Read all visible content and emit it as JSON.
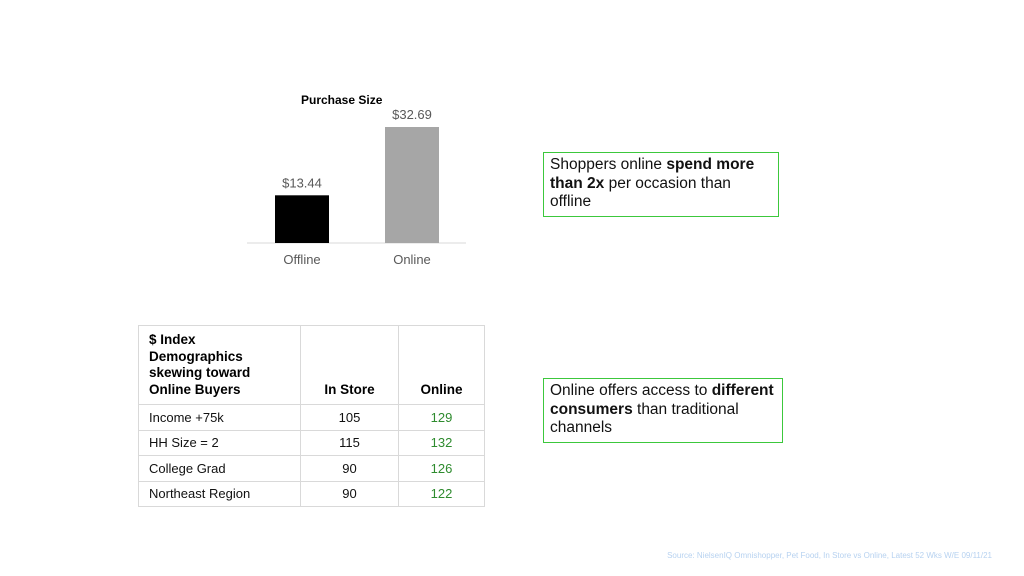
{
  "chart_data": {
    "type": "bar",
    "title": "Purchase Size",
    "categories": [
      "Offline",
      "Online"
    ],
    "values": [
      13.44,
      32.69
    ],
    "data_labels": [
      "$13.44",
      "$32.69"
    ],
    "colors": [
      "#000000",
      "#a6a6a6"
    ],
    "ylim": [
      0,
      32.69
    ],
    "grid": false,
    "legend": "none"
  },
  "callouts": [
    {
      "before": "Shoppers online ",
      "bold": "spend more than 2x",
      "after": " per occasion than offline"
    },
    {
      "before": "Online offers access to ",
      "bold": "different consumers",
      "after": " than traditional channels"
    }
  ],
  "table": {
    "header_lines": [
      "$ Index",
      "Demographics",
      "skewing toward",
      "Online Buyers"
    ],
    "col_store": "In Store",
    "col_online": "Online",
    "rows": [
      {
        "label": "Income +75k",
        "store": "105",
        "online": "129"
      },
      {
        "label": "HH Size = 2",
        "store": "115",
        "online": "132"
      },
      {
        "label": "College Grad",
        "store": "90",
        "online": "126"
      },
      {
        "label": "Northeast Region",
        "store": "90",
        "online": "122"
      }
    ]
  },
  "source": "Source: NielsenIQ Omnishopper, Pet Food, In Store vs Online, Latest 52 Wks W/E 09/11/21",
  "accent": "#3cc83c",
  "positive_color": "#2e8b2e"
}
